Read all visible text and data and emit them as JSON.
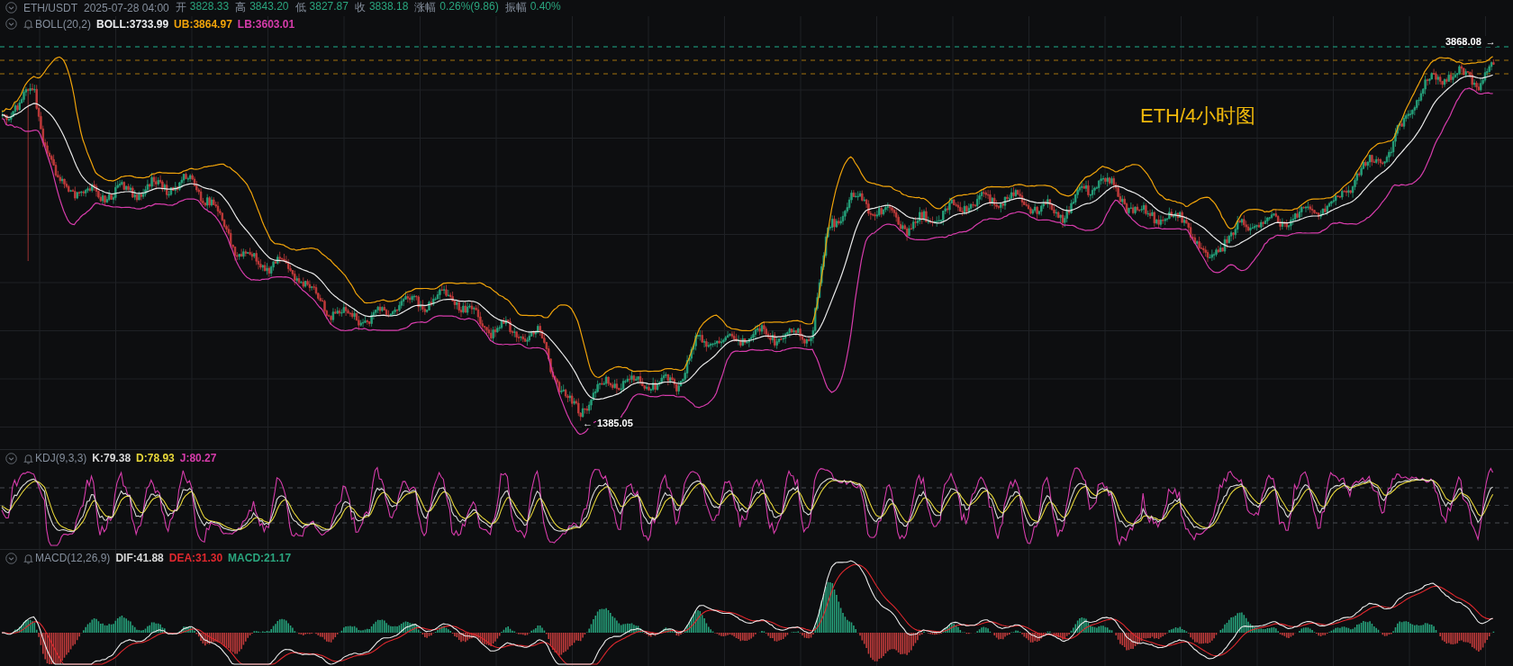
{
  "ticker": {
    "symbol": "ETH/USDT",
    "time": "2025-07-28 04:00",
    "fields": [
      {
        "label": "开",
        "value": "3828.33"
      },
      {
        "label": "高",
        "value": "3843.20"
      },
      {
        "label": "低",
        "value": "3827.87"
      },
      {
        "label": "收",
        "value": "3838.18"
      },
      {
        "label": "涨幅",
        "value": "0.26%(9.86)"
      },
      {
        "label": "振幅",
        "value": "0.40%"
      }
    ]
  },
  "panes": [
    {
      "kind": "boll",
      "name": "BOLL(20,2)",
      "values": [
        {
          "text": "BOLL:3733.99",
          "color": "#eaecef"
        },
        {
          "text": "UB:3864.97",
          "color": "#f0a30a"
        },
        {
          "text": "LB:3603.01",
          "color": "#d63cab"
        }
      ]
    },
    {
      "kind": "kdj",
      "name": "KDJ(9,3,3)",
      "values": [
        {
          "text": "K:79.38",
          "color": "#d8d8d8"
        },
        {
          "text": "D:78.93",
          "color": "#e8d83a"
        },
        {
          "text": "J:80.27",
          "color": "#d63cab"
        }
      ]
    },
    {
      "kind": "macd",
      "name": "MACD(12,26,9)",
      "values": [
        {
          "text": "DIF:41.88",
          "color": "#d8d8d8"
        },
        {
          "text": "DEA:31.30",
          "color": "#e0282e"
        },
        {
          "text": "MACD:21.17",
          "color": "#2aa57e"
        }
      ]
    }
  ],
  "chart_title": "ETH/4小时图",
  "high_marker": {
    "value": "3868.08",
    "arrow": "→"
  },
  "low_marker": {
    "arrow": "←",
    "value": "1385.05"
  }
}
